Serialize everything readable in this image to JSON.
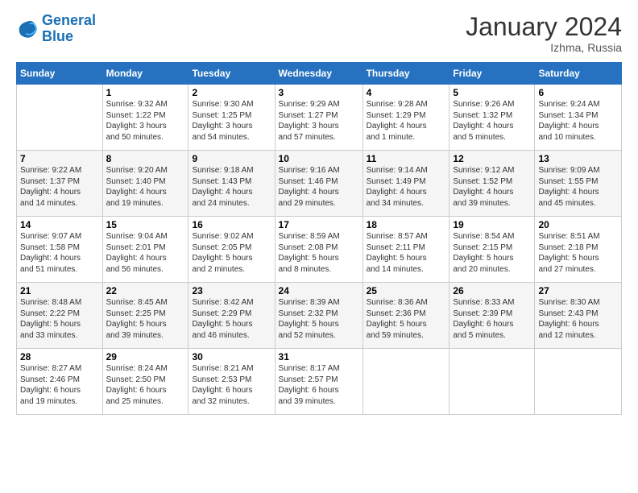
{
  "logo": {
    "line1": "General",
    "line2": "Blue"
  },
  "title": "January 2024",
  "subtitle": "Izhma, Russia",
  "days_header": [
    "Sunday",
    "Monday",
    "Tuesday",
    "Wednesday",
    "Thursday",
    "Friday",
    "Saturday"
  ],
  "weeks": [
    [
      {
        "num": "",
        "info": ""
      },
      {
        "num": "1",
        "info": "Sunrise: 9:32 AM\nSunset: 1:22 PM\nDaylight: 3 hours\nand 50 minutes."
      },
      {
        "num": "2",
        "info": "Sunrise: 9:30 AM\nSunset: 1:25 PM\nDaylight: 3 hours\nand 54 minutes."
      },
      {
        "num": "3",
        "info": "Sunrise: 9:29 AM\nSunset: 1:27 PM\nDaylight: 3 hours\nand 57 minutes."
      },
      {
        "num": "4",
        "info": "Sunrise: 9:28 AM\nSunset: 1:29 PM\nDaylight: 4 hours\nand 1 minute."
      },
      {
        "num": "5",
        "info": "Sunrise: 9:26 AM\nSunset: 1:32 PM\nDaylight: 4 hours\nand 5 minutes."
      },
      {
        "num": "6",
        "info": "Sunrise: 9:24 AM\nSunset: 1:34 PM\nDaylight: 4 hours\nand 10 minutes."
      }
    ],
    [
      {
        "num": "7",
        "info": "Sunrise: 9:22 AM\nSunset: 1:37 PM\nDaylight: 4 hours\nand 14 minutes."
      },
      {
        "num": "8",
        "info": "Sunrise: 9:20 AM\nSunset: 1:40 PM\nDaylight: 4 hours\nand 19 minutes."
      },
      {
        "num": "9",
        "info": "Sunrise: 9:18 AM\nSunset: 1:43 PM\nDaylight: 4 hours\nand 24 minutes."
      },
      {
        "num": "10",
        "info": "Sunrise: 9:16 AM\nSunset: 1:46 PM\nDaylight: 4 hours\nand 29 minutes."
      },
      {
        "num": "11",
        "info": "Sunrise: 9:14 AM\nSunset: 1:49 PM\nDaylight: 4 hours\nand 34 minutes."
      },
      {
        "num": "12",
        "info": "Sunrise: 9:12 AM\nSunset: 1:52 PM\nDaylight: 4 hours\nand 39 minutes."
      },
      {
        "num": "13",
        "info": "Sunrise: 9:09 AM\nSunset: 1:55 PM\nDaylight: 4 hours\nand 45 minutes."
      }
    ],
    [
      {
        "num": "14",
        "info": "Sunrise: 9:07 AM\nSunset: 1:58 PM\nDaylight: 4 hours\nand 51 minutes."
      },
      {
        "num": "15",
        "info": "Sunrise: 9:04 AM\nSunset: 2:01 PM\nDaylight: 4 hours\nand 56 minutes."
      },
      {
        "num": "16",
        "info": "Sunrise: 9:02 AM\nSunset: 2:05 PM\nDaylight: 5 hours\nand 2 minutes."
      },
      {
        "num": "17",
        "info": "Sunrise: 8:59 AM\nSunset: 2:08 PM\nDaylight: 5 hours\nand 8 minutes."
      },
      {
        "num": "18",
        "info": "Sunrise: 8:57 AM\nSunset: 2:11 PM\nDaylight: 5 hours\nand 14 minutes."
      },
      {
        "num": "19",
        "info": "Sunrise: 8:54 AM\nSunset: 2:15 PM\nDaylight: 5 hours\nand 20 minutes."
      },
      {
        "num": "20",
        "info": "Sunrise: 8:51 AM\nSunset: 2:18 PM\nDaylight: 5 hours\nand 27 minutes."
      }
    ],
    [
      {
        "num": "21",
        "info": "Sunrise: 8:48 AM\nSunset: 2:22 PM\nDaylight: 5 hours\nand 33 minutes."
      },
      {
        "num": "22",
        "info": "Sunrise: 8:45 AM\nSunset: 2:25 PM\nDaylight: 5 hours\nand 39 minutes."
      },
      {
        "num": "23",
        "info": "Sunrise: 8:42 AM\nSunset: 2:29 PM\nDaylight: 5 hours\nand 46 minutes."
      },
      {
        "num": "24",
        "info": "Sunrise: 8:39 AM\nSunset: 2:32 PM\nDaylight: 5 hours\nand 52 minutes."
      },
      {
        "num": "25",
        "info": "Sunrise: 8:36 AM\nSunset: 2:36 PM\nDaylight: 5 hours\nand 59 minutes."
      },
      {
        "num": "26",
        "info": "Sunrise: 8:33 AM\nSunset: 2:39 PM\nDaylight: 6 hours\nand 5 minutes."
      },
      {
        "num": "27",
        "info": "Sunrise: 8:30 AM\nSunset: 2:43 PM\nDaylight: 6 hours\nand 12 minutes."
      }
    ],
    [
      {
        "num": "28",
        "info": "Sunrise: 8:27 AM\nSunset: 2:46 PM\nDaylight: 6 hours\nand 19 minutes."
      },
      {
        "num": "29",
        "info": "Sunrise: 8:24 AM\nSunset: 2:50 PM\nDaylight: 6 hours\nand 25 minutes."
      },
      {
        "num": "30",
        "info": "Sunrise: 8:21 AM\nSunset: 2:53 PM\nDaylight: 6 hours\nand 32 minutes."
      },
      {
        "num": "31",
        "info": "Sunrise: 8:17 AM\nSunset: 2:57 PM\nDaylight: 6 hours\nand 39 minutes."
      },
      {
        "num": "",
        "info": ""
      },
      {
        "num": "",
        "info": ""
      },
      {
        "num": "",
        "info": ""
      }
    ]
  ]
}
